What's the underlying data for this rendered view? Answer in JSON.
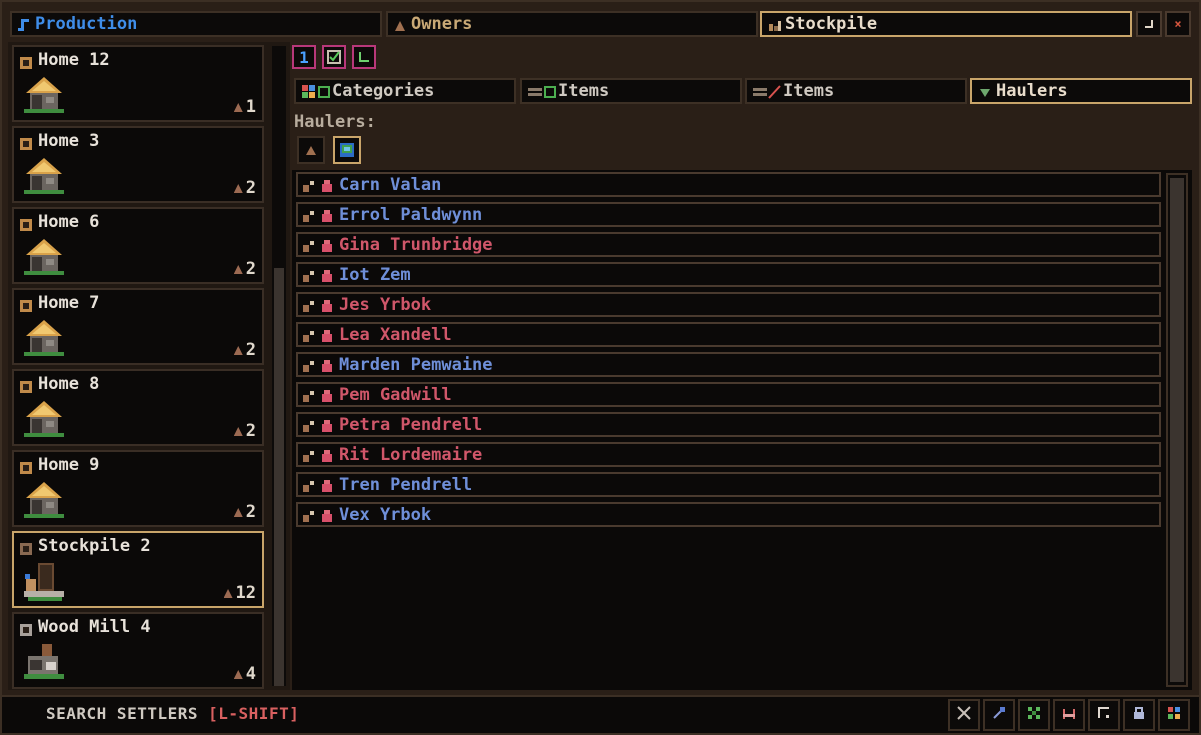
{
  "tabs": {
    "production": "Production",
    "owners": "Owners",
    "stockpile": "Stockpile"
  },
  "window_buttons": {
    "minimize": "▭",
    "close": "×"
  },
  "buildings": [
    {
      "name": "Home 12",
      "count": "1",
      "type": "home"
    },
    {
      "name": "Home 3",
      "count": "2",
      "type": "home"
    },
    {
      "name": "Home 6",
      "count": "2",
      "type": "home"
    },
    {
      "name": "Home 7",
      "count": "2",
      "type": "home"
    },
    {
      "name": "Home 8",
      "count": "2",
      "type": "home"
    },
    {
      "name": "Home 9",
      "count": "2",
      "type": "home"
    },
    {
      "name": "Stockpile 2",
      "count": "12",
      "type": "stockpile",
      "selected": true
    },
    {
      "name": "Wood Mill 4",
      "count": "4",
      "type": "mill"
    }
  ],
  "sub_buttons": [
    "1",
    "☑",
    "↘"
  ],
  "filter_tabs": {
    "categories": "Categories",
    "items_allowed": "Items",
    "items_disallowed": "Items",
    "haulers": "Haulers"
  },
  "haulers_label": "Haulers:",
  "haulers": [
    {
      "name": "Carn Valan",
      "gender": "male"
    },
    {
      "name": "Errol Paldwynn",
      "gender": "male"
    },
    {
      "name": "Gina Trunbridge",
      "gender": "female"
    },
    {
      "name": "Iot Zem",
      "gender": "male"
    },
    {
      "name": "Jes Yrbok",
      "gender": "female"
    },
    {
      "name": "Lea Xandell",
      "gender": "female"
    },
    {
      "name": "Marden Pemwaine",
      "gender": "male"
    },
    {
      "name": "Pem Gadwill",
      "gender": "female"
    },
    {
      "name": "Petra Pendrell",
      "gender": "female"
    },
    {
      "name": "Rit Lordemaire",
      "gender": "female"
    },
    {
      "name": "Tren Pendrell",
      "gender": "male"
    },
    {
      "name": "Vex Yrbok",
      "gender": "male"
    }
  ],
  "search": {
    "label": "SEARCH SETTLERS",
    "key": "[L-SHIFT]"
  },
  "toolbar_icons": [
    "tools-icon",
    "hammer-icon",
    "plants-icon",
    "bed-icon",
    "zone-icon",
    "lock-icon",
    "palette-icon"
  ],
  "colors": {
    "male_name": "#6f8fd8",
    "female_name": "#d0576a",
    "active_border": "#c9a56a",
    "production_tab": "#3f8de8",
    "sub_button_border": "#b8387a"
  }
}
